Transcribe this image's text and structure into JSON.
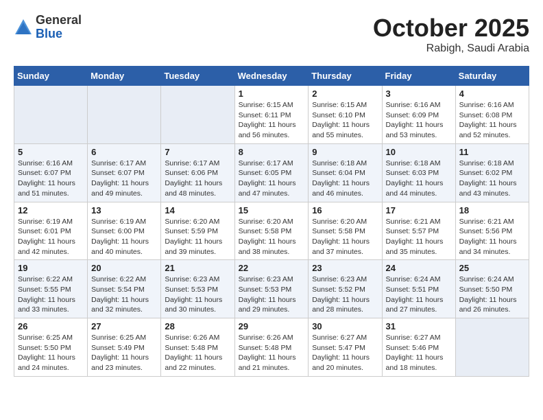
{
  "logo": {
    "general": "General",
    "blue": "Blue"
  },
  "title": "October 2025",
  "location": "Rabigh, Saudi Arabia",
  "days_header": [
    "Sunday",
    "Monday",
    "Tuesday",
    "Wednesday",
    "Thursday",
    "Friday",
    "Saturday"
  ],
  "weeks": [
    [
      {
        "num": "",
        "sunrise": "",
        "sunset": "",
        "daylight": ""
      },
      {
        "num": "",
        "sunrise": "",
        "sunset": "",
        "daylight": ""
      },
      {
        "num": "",
        "sunrise": "",
        "sunset": "",
        "daylight": ""
      },
      {
        "num": "1",
        "sunrise": "Sunrise: 6:15 AM",
        "sunset": "Sunset: 6:11 PM",
        "daylight": "Daylight: 11 hours and 56 minutes."
      },
      {
        "num": "2",
        "sunrise": "Sunrise: 6:15 AM",
        "sunset": "Sunset: 6:10 PM",
        "daylight": "Daylight: 11 hours and 55 minutes."
      },
      {
        "num": "3",
        "sunrise": "Sunrise: 6:16 AM",
        "sunset": "Sunset: 6:09 PM",
        "daylight": "Daylight: 11 hours and 53 minutes."
      },
      {
        "num": "4",
        "sunrise": "Sunrise: 6:16 AM",
        "sunset": "Sunset: 6:08 PM",
        "daylight": "Daylight: 11 hours and 52 minutes."
      }
    ],
    [
      {
        "num": "5",
        "sunrise": "Sunrise: 6:16 AM",
        "sunset": "Sunset: 6:07 PM",
        "daylight": "Daylight: 11 hours and 51 minutes."
      },
      {
        "num": "6",
        "sunrise": "Sunrise: 6:17 AM",
        "sunset": "Sunset: 6:07 PM",
        "daylight": "Daylight: 11 hours and 49 minutes."
      },
      {
        "num": "7",
        "sunrise": "Sunrise: 6:17 AM",
        "sunset": "Sunset: 6:06 PM",
        "daylight": "Daylight: 11 hours and 48 minutes."
      },
      {
        "num": "8",
        "sunrise": "Sunrise: 6:17 AM",
        "sunset": "Sunset: 6:05 PM",
        "daylight": "Daylight: 11 hours and 47 minutes."
      },
      {
        "num": "9",
        "sunrise": "Sunrise: 6:18 AM",
        "sunset": "Sunset: 6:04 PM",
        "daylight": "Daylight: 11 hours and 46 minutes."
      },
      {
        "num": "10",
        "sunrise": "Sunrise: 6:18 AM",
        "sunset": "Sunset: 6:03 PM",
        "daylight": "Daylight: 11 hours and 44 minutes."
      },
      {
        "num": "11",
        "sunrise": "Sunrise: 6:18 AM",
        "sunset": "Sunset: 6:02 PM",
        "daylight": "Daylight: 11 hours and 43 minutes."
      }
    ],
    [
      {
        "num": "12",
        "sunrise": "Sunrise: 6:19 AM",
        "sunset": "Sunset: 6:01 PM",
        "daylight": "Daylight: 11 hours and 42 minutes."
      },
      {
        "num": "13",
        "sunrise": "Sunrise: 6:19 AM",
        "sunset": "Sunset: 6:00 PM",
        "daylight": "Daylight: 11 hours and 40 minutes."
      },
      {
        "num": "14",
        "sunrise": "Sunrise: 6:20 AM",
        "sunset": "Sunset: 5:59 PM",
        "daylight": "Daylight: 11 hours and 39 minutes."
      },
      {
        "num": "15",
        "sunrise": "Sunrise: 6:20 AM",
        "sunset": "Sunset: 5:58 PM",
        "daylight": "Daylight: 11 hours and 38 minutes."
      },
      {
        "num": "16",
        "sunrise": "Sunrise: 6:20 AM",
        "sunset": "Sunset: 5:58 PM",
        "daylight": "Daylight: 11 hours and 37 minutes."
      },
      {
        "num": "17",
        "sunrise": "Sunrise: 6:21 AM",
        "sunset": "Sunset: 5:57 PM",
        "daylight": "Daylight: 11 hours and 35 minutes."
      },
      {
        "num": "18",
        "sunrise": "Sunrise: 6:21 AM",
        "sunset": "Sunset: 5:56 PM",
        "daylight": "Daylight: 11 hours and 34 minutes."
      }
    ],
    [
      {
        "num": "19",
        "sunrise": "Sunrise: 6:22 AM",
        "sunset": "Sunset: 5:55 PM",
        "daylight": "Daylight: 11 hours and 33 minutes."
      },
      {
        "num": "20",
        "sunrise": "Sunrise: 6:22 AM",
        "sunset": "Sunset: 5:54 PM",
        "daylight": "Daylight: 11 hours and 32 minutes."
      },
      {
        "num": "21",
        "sunrise": "Sunrise: 6:23 AM",
        "sunset": "Sunset: 5:53 PM",
        "daylight": "Daylight: 11 hours and 30 minutes."
      },
      {
        "num": "22",
        "sunrise": "Sunrise: 6:23 AM",
        "sunset": "Sunset: 5:53 PM",
        "daylight": "Daylight: 11 hours and 29 minutes."
      },
      {
        "num": "23",
        "sunrise": "Sunrise: 6:23 AM",
        "sunset": "Sunset: 5:52 PM",
        "daylight": "Daylight: 11 hours and 28 minutes."
      },
      {
        "num": "24",
        "sunrise": "Sunrise: 6:24 AM",
        "sunset": "Sunset: 5:51 PM",
        "daylight": "Daylight: 11 hours and 27 minutes."
      },
      {
        "num": "25",
        "sunrise": "Sunrise: 6:24 AM",
        "sunset": "Sunset: 5:50 PM",
        "daylight": "Daylight: 11 hours and 26 minutes."
      }
    ],
    [
      {
        "num": "26",
        "sunrise": "Sunrise: 6:25 AM",
        "sunset": "Sunset: 5:50 PM",
        "daylight": "Daylight: 11 hours and 24 minutes."
      },
      {
        "num": "27",
        "sunrise": "Sunrise: 6:25 AM",
        "sunset": "Sunset: 5:49 PM",
        "daylight": "Daylight: 11 hours and 23 minutes."
      },
      {
        "num": "28",
        "sunrise": "Sunrise: 6:26 AM",
        "sunset": "Sunset: 5:48 PM",
        "daylight": "Daylight: 11 hours and 22 minutes."
      },
      {
        "num": "29",
        "sunrise": "Sunrise: 6:26 AM",
        "sunset": "Sunset: 5:48 PM",
        "daylight": "Daylight: 11 hours and 21 minutes."
      },
      {
        "num": "30",
        "sunrise": "Sunrise: 6:27 AM",
        "sunset": "Sunset: 5:47 PM",
        "daylight": "Daylight: 11 hours and 20 minutes."
      },
      {
        "num": "31",
        "sunrise": "Sunrise: 6:27 AM",
        "sunset": "Sunset: 5:46 PM",
        "daylight": "Daylight: 11 hours and 18 minutes."
      },
      {
        "num": "",
        "sunrise": "",
        "sunset": "",
        "daylight": ""
      }
    ]
  ]
}
